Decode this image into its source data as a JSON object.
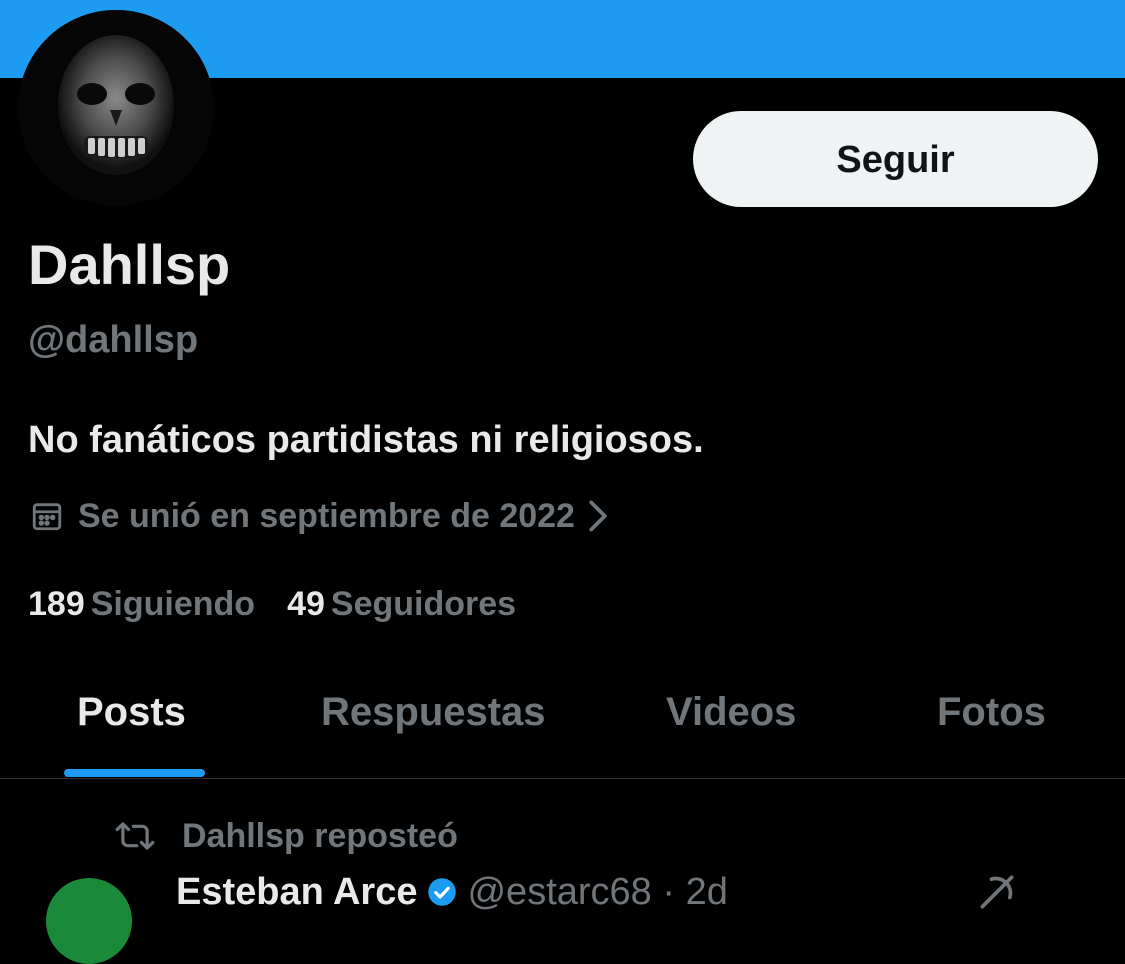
{
  "profile": {
    "display_name": "Dahllsp",
    "handle": "@dahllsp",
    "bio": "No fanáticos partidistas ni religiosos.",
    "joined": "Se unió en septiembre de 2022",
    "following_count": "189",
    "following_label": "Siguiendo",
    "followers_count": "49",
    "followers_label": "Seguidores",
    "avatar_icon": "skull-avatar"
  },
  "actions": {
    "follow_label": "Seguir"
  },
  "tabs": [
    {
      "label": "Posts",
      "active": true
    },
    {
      "label": "Respuestas",
      "active": false
    },
    {
      "label": "Videos",
      "active": false
    },
    {
      "label": "Fotos",
      "active": false
    }
  ],
  "feed": {
    "repost_text": "Dahllsp reposteó",
    "post": {
      "author": "Esteban Arce",
      "meta": "@estarc68 · 2d"
    }
  },
  "colors": {
    "accent": "#1d9bf0",
    "background": "#000000",
    "text_primary": "#e7e9ea",
    "text_secondary": "#71767b",
    "button_bg": "#eff3f4"
  }
}
